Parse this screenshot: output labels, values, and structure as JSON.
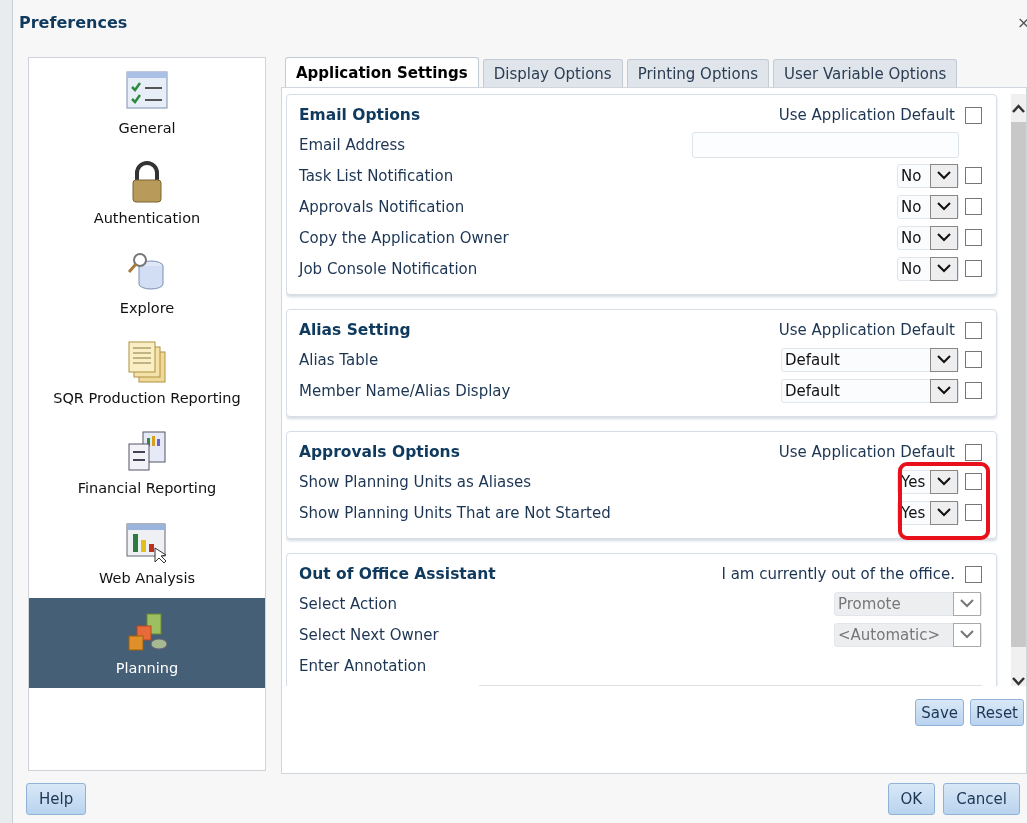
{
  "window": {
    "title": "Preferences",
    "close": "×"
  },
  "sidebar": {
    "items": [
      {
        "label": "General",
        "selected": false
      },
      {
        "label": "Authentication",
        "selected": false
      },
      {
        "label": "Explore",
        "selected": false
      },
      {
        "label": "SQR Production Reporting",
        "selected": false
      },
      {
        "label": "Financial Reporting",
        "selected": false
      },
      {
        "label": "Web Analysis",
        "selected": false
      },
      {
        "label": "Planning",
        "selected": true
      }
    ]
  },
  "tabs": [
    {
      "label": "Application Settings",
      "selected": true
    },
    {
      "label": "Display Options",
      "selected": false
    },
    {
      "label": "Printing Options",
      "selected": false
    },
    {
      "label": "User Variable Options",
      "selected": false
    }
  ],
  "sections": [
    {
      "title": "Email Options",
      "option_label": "Use Application Default",
      "option_checked": false,
      "highlighted": false,
      "rows": [
        {
          "label": "Email Address",
          "kind": "text"
        },
        {
          "label": "Task List Notification",
          "kind": "toggle",
          "value": "No",
          "default_checked": false,
          "disabled": false
        },
        {
          "label": "Approvals Notification",
          "kind": "toggle",
          "value": "No",
          "default_checked": false,
          "disabled": false
        },
        {
          "label": "Copy the Application Owner",
          "kind": "toggle",
          "value": "No",
          "default_checked": false,
          "disabled": false
        },
        {
          "label": "Job Console Notification",
          "kind": "toggle",
          "value": "No",
          "default_checked": false,
          "disabled": false
        }
      ]
    },
    {
      "title": "Alias Setting",
      "option_label": "Use Application Default",
      "option_checked": false,
      "highlighted": false,
      "rows": [
        {
          "label": "Alias Table",
          "kind": "dropdown",
          "value": "Default",
          "default_checked": false,
          "disabled": false
        },
        {
          "label": "Member Name/Alias Display",
          "kind": "dropdown",
          "value": "Default",
          "default_checked": false,
          "disabled": false
        }
      ]
    },
    {
      "title": "Approvals Options",
      "option_label": "Use Application Default",
      "option_checked": false,
      "highlighted": true,
      "rows": [
        {
          "label": "Show Planning Units as Aliases",
          "kind": "toggle",
          "value": "Yes",
          "default_checked": false,
          "disabled": false
        },
        {
          "label": "Show Planning Units That are Not Started",
          "kind": "toggle",
          "value": "Yes",
          "default_checked": false,
          "disabled": false
        }
      ]
    },
    {
      "title": "Out of Office Assistant",
      "option_label": "I am currently out of the office.",
      "option_checked": false,
      "highlighted": false,
      "rows": [
        {
          "label": "Select Action",
          "kind": "dropdown",
          "value": "Promote",
          "disabled": true
        },
        {
          "label": "Select Next Owner",
          "kind": "dropdown",
          "value": "<Automatic>",
          "disabled": true
        },
        {
          "label": "Enter Annotation",
          "kind": "textarea"
        }
      ]
    }
  ],
  "panel_buttons": [
    "Save",
    "Reset"
  ],
  "footer": {
    "help": "Help",
    "buttons": [
      "OK",
      "Cancel"
    ]
  }
}
